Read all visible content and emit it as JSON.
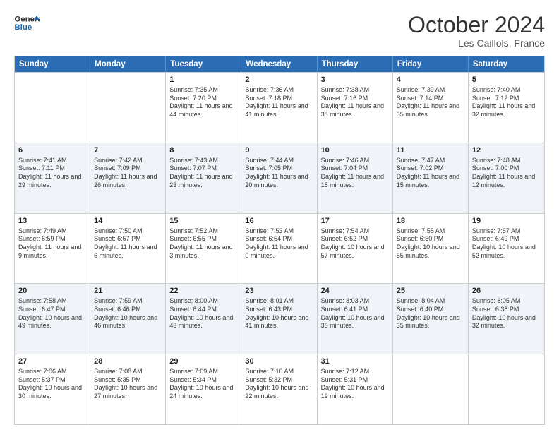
{
  "header": {
    "logo_line1": "General",
    "logo_line2": "Blue",
    "month": "October 2024",
    "location": "Les Caillols, France"
  },
  "weekdays": [
    "Sunday",
    "Monday",
    "Tuesday",
    "Wednesday",
    "Thursday",
    "Friday",
    "Saturday"
  ],
  "rows": [
    [
      {
        "day": "",
        "sunrise": "",
        "sunset": "",
        "daylight": ""
      },
      {
        "day": "",
        "sunrise": "",
        "sunset": "",
        "daylight": ""
      },
      {
        "day": "1",
        "sunrise": "Sunrise: 7:35 AM",
        "sunset": "Sunset: 7:20 PM",
        "daylight": "Daylight: 11 hours and 44 minutes."
      },
      {
        "day": "2",
        "sunrise": "Sunrise: 7:36 AM",
        "sunset": "Sunset: 7:18 PM",
        "daylight": "Daylight: 11 hours and 41 minutes."
      },
      {
        "day": "3",
        "sunrise": "Sunrise: 7:38 AM",
        "sunset": "Sunset: 7:16 PM",
        "daylight": "Daylight: 11 hours and 38 minutes."
      },
      {
        "day": "4",
        "sunrise": "Sunrise: 7:39 AM",
        "sunset": "Sunset: 7:14 PM",
        "daylight": "Daylight: 11 hours and 35 minutes."
      },
      {
        "day": "5",
        "sunrise": "Sunrise: 7:40 AM",
        "sunset": "Sunset: 7:12 PM",
        "daylight": "Daylight: 11 hours and 32 minutes."
      }
    ],
    [
      {
        "day": "6",
        "sunrise": "Sunrise: 7:41 AM",
        "sunset": "Sunset: 7:11 PM",
        "daylight": "Daylight: 11 hours and 29 minutes."
      },
      {
        "day": "7",
        "sunrise": "Sunrise: 7:42 AM",
        "sunset": "Sunset: 7:09 PM",
        "daylight": "Daylight: 11 hours and 26 minutes."
      },
      {
        "day": "8",
        "sunrise": "Sunrise: 7:43 AM",
        "sunset": "Sunset: 7:07 PM",
        "daylight": "Daylight: 11 hours and 23 minutes."
      },
      {
        "day": "9",
        "sunrise": "Sunrise: 7:44 AM",
        "sunset": "Sunset: 7:05 PM",
        "daylight": "Daylight: 11 hours and 20 minutes."
      },
      {
        "day": "10",
        "sunrise": "Sunrise: 7:46 AM",
        "sunset": "Sunset: 7:04 PM",
        "daylight": "Daylight: 11 hours and 18 minutes."
      },
      {
        "day": "11",
        "sunrise": "Sunrise: 7:47 AM",
        "sunset": "Sunset: 7:02 PM",
        "daylight": "Daylight: 11 hours and 15 minutes."
      },
      {
        "day": "12",
        "sunrise": "Sunrise: 7:48 AM",
        "sunset": "Sunset: 7:00 PM",
        "daylight": "Daylight: 11 hours and 12 minutes."
      }
    ],
    [
      {
        "day": "13",
        "sunrise": "Sunrise: 7:49 AM",
        "sunset": "Sunset: 6:59 PM",
        "daylight": "Daylight: 11 hours and 9 minutes."
      },
      {
        "day": "14",
        "sunrise": "Sunrise: 7:50 AM",
        "sunset": "Sunset: 6:57 PM",
        "daylight": "Daylight: 11 hours and 6 minutes."
      },
      {
        "day": "15",
        "sunrise": "Sunrise: 7:52 AM",
        "sunset": "Sunset: 6:55 PM",
        "daylight": "Daylight: 11 hours and 3 minutes."
      },
      {
        "day": "16",
        "sunrise": "Sunrise: 7:53 AM",
        "sunset": "Sunset: 6:54 PM",
        "daylight": "Daylight: 11 hours and 0 minutes."
      },
      {
        "day": "17",
        "sunrise": "Sunrise: 7:54 AM",
        "sunset": "Sunset: 6:52 PM",
        "daylight": "Daylight: 10 hours and 57 minutes."
      },
      {
        "day": "18",
        "sunrise": "Sunrise: 7:55 AM",
        "sunset": "Sunset: 6:50 PM",
        "daylight": "Daylight: 10 hours and 55 minutes."
      },
      {
        "day": "19",
        "sunrise": "Sunrise: 7:57 AM",
        "sunset": "Sunset: 6:49 PM",
        "daylight": "Daylight: 10 hours and 52 minutes."
      }
    ],
    [
      {
        "day": "20",
        "sunrise": "Sunrise: 7:58 AM",
        "sunset": "Sunset: 6:47 PM",
        "daylight": "Daylight: 10 hours and 49 minutes."
      },
      {
        "day": "21",
        "sunrise": "Sunrise: 7:59 AM",
        "sunset": "Sunset: 6:46 PM",
        "daylight": "Daylight: 10 hours and 46 minutes."
      },
      {
        "day": "22",
        "sunrise": "Sunrise: 8:00 AM",
        "sunset": "Sunset: 6:44 PM",
        "daylight": "Daylight: 10 hours and 43 minutes."
      },
      {
        "day": "23",
        "sunrise": "Sunrise: 8:01 AM",
        "sunset": "Sunset: 6:43 PM",
        "daylight": "Daylight: 10 hours and 41 minutes."
      },
      {
        "day": "24",
        "sunrise": "Sunrise: 8:03 AM",
        "sunset": "Sunset: 6:41 PM",
        "daylight": "Daylight: 10 hours and 38 minutes."
      },
      {
        "day": "25",
        "sunrise": "Sunrise: 8:04 AM",
        "sunset": "Sunset: 6:40 PM",
        "daylight": "Daylight: 10 hours and 35 minutes."
      },
      {
        "day": "26",
        "sunrise": "Sunrise: 8:05 AM",
        "sunset": "Sunset: 6:38 PM",
        "daylight": "Daylight: 10 hours and 32 minutes."
      }
    ],
    [
      {
        "day": "27",
        "sunrise": "Sunrise: 7:06 AM",
        "sunset": "Sunset: 5:37 PM",
        "daylight": "Daylight: 10 hours and 30 minutes."
      },
      {
        "day": "28",
        "sunrise": "Sunrise: 7:08 AM",
        "sunset": "Sunset: 5:35 PM",
        "daylight": "Daylight: 10 hours and 27 minutes."
      },
      {
        "day": "29",
        "sunrise": "Sunrise: 7:09 AM",
        "sunset": "Sunset: 5:34 PM",
        "daylight": "Daylight: 10 hours and 24 minutes."
      },
      {
        "day": "30",
        "sunrise": "Sunrise: 7:10 AM",
        "sunset": "Sunset: 5:32 PM",
        "daylight": "Daylight: 10 hours and 22 minutes."
      },
      {
        "day": "31",
        "sunrise": "Sunrise: 7:12 AM",
        "sunset": "Sunset: 5:31 PM",
        "daylight": "Daylight: 10 hours and 19 minutes."
      },
      {
        "day": "",
        "sunrise": "",
        "sunset": "",
        "daylight": ""
      },
      {
        "day": "",
        "sunrise": "",
        "sunset": "",
        "daylight": ""
      }
    ]
  ]
}
